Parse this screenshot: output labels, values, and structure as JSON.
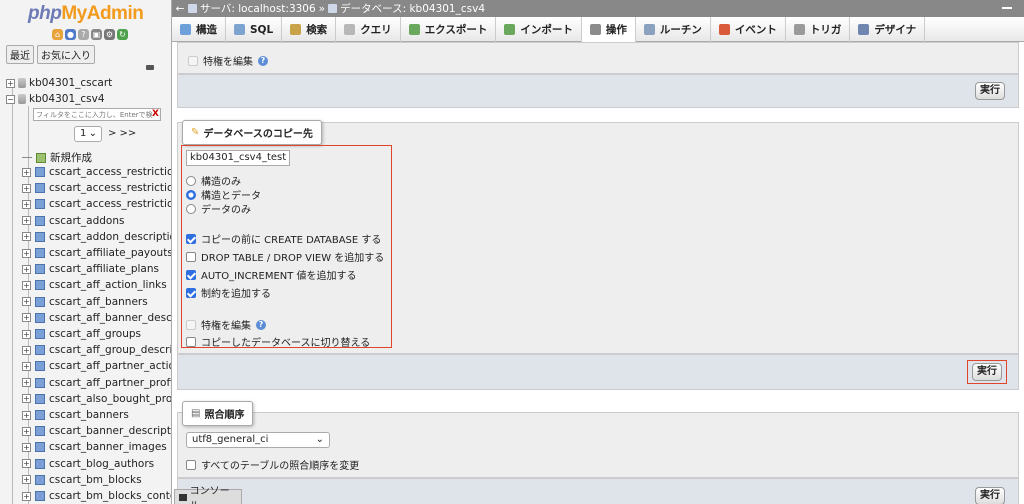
{
  "sidebar": {
    "logo_a": "php",
    "logo_b": "MyAdmin",
    "recent_label": "最近",
    "favorites_label": "お気に入り",
    "databases": [
      {
        "name": "kb04301_cscart",
        "toggle": "+"
      },
      {
        "name": "kb04301_csv4",
        "toggle": "−"
      }
    ],
    "filter_placeholder": "フィルタをここに入力し、Enterで検",
    "filter_clear": "X",
    "page_value": "1",
    "page_next": "> >>",
    "new_item": "新規作成",
    "tables": [
      "cscart_access_restriction",
      "cscart_access_restriction_",
      "cscart_access_restriction_",
      "cscart_addons",
      "cscart_addon_descriptions",
      "cscart_affiliate_payouts",
      "cscart_affiliate_plans",
      "cscart_aff_action_links",
      "cscart_aff_banners",
      "cscart_aff_banner_descrip",
      "cscart_aff_groups",
      "cscart_aff_group_descripti",
      "cscart_aff_partner_actions",
      "cscart_aff_partner_profiles",
      "cscart_also_bought_produ",
      "cscart_banners",
      "cscart_banner_description",
      "cscart_banner_images",
      "cscart_blog_authors",
      "cscart_bm_blocks",
      "cscart_bm_blocks_content"
    ]
  },
  "topbar": {
    "back": "←",
    "server": "サーバ: localhost:3306",
    "sep": "»",
    "database": "データベース: kb04301_csv4"
  },
  "tabs": [
    {
      "label": "構造",
      "icon": "structure-icon",
      "color": "#6d9fd8"
    },
    {
      "label": "SQL",
      "icon": "sql-icon",
      "color": "#7da4d0"
    },
    {
      "label": "検索",
      "icon": "search-icon",
      "color": "#c9a34a"
    },
    {
      "label": "クエリ",
      "icon": "query-icon",
      "color": "#b7b7b7"
    },
    {
      "label": "エクスポート",
      "icon": "export-icon",
      "color": "#6aa85d"
    },
    {
      "label": "インポート",
      "icon": "import-icon",
      "color": "#6aa85d"
    },
    {
      "label": "操作",
      "icon": "wrench-icon",
      "color": "#8c8c8c"
    },
    {
      "label": "ルーチン",
      "icon": "routine-icon",
      "color": "#8aa1bf"
    },
    {
      "label": "イベント",
      "icon": "clock-icon",
      "color": "#d85a3a"
    },
    {
      "label": "トリガ",
      "icon": "trigger-icon",
      "color": "#9a9a9a"
    },
    {
      "label": "デザイナ",
      "icon": "designer-icon",
      "color": "#6e86b0"
    }
  ],
  "panel1": {
    "privileges_label": "特権を編集",
    "exec_label": "実行"
  },
  "copy_panel": {
    "legend": "データベースのコピー先",
    "db_name_value": "kb04301_csv4_test",
    "radios": [
      {
        "label": "構造のみ",
        "checked": false
      },
      {
        "label": "構造とデータ",
        "checked": true
      },
      {
        "label": "データのみ",
        "checked": false
      }
    ],
    "checks": [
      {
        "label": "コピーの前に CREATE DATABASE する",
        "checked": true
      },
      {
        "label": "DROP TABLE / DROP VIEW を追加する",
        "checked": false
      },
      {
        "label": "AUTO_INCREMENT 値を追加する",
        "checked": true
      },
      {
        "label": "制約を追加する",
        "checked": true
      }
    ],
    "privileges_label": "特権を編集",
    "switch_label": "コピーしたデータベースに切り替える",
    "exec_label": "実行"
  },
  "collation_panel": {
    "legend": "照合順序",
    "select_value": "utf8_general_ci",
    "all_tables_label": "すべてのテーブルの照合順序を変更",
    "exec_label": "実行"
  },
  "console_label": "コンソール",
  "colors": {
    "highlight": "#e0442a",
    "checkbox_accent": "#2f6fe0"
  }
}
